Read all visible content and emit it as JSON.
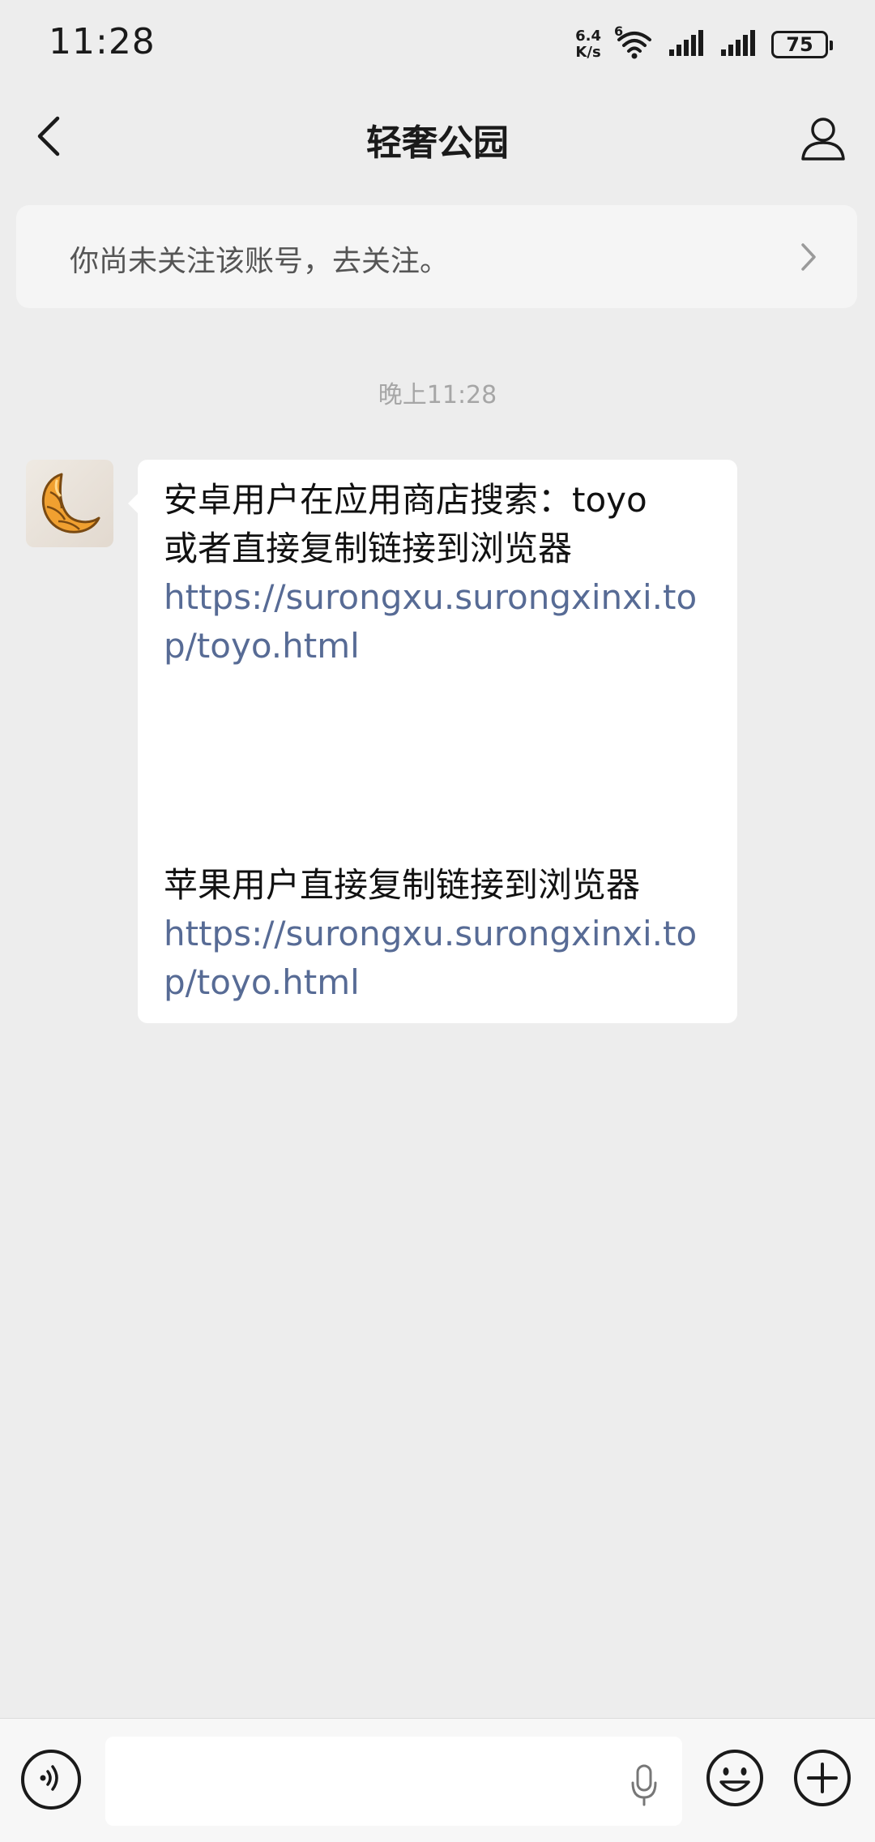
{
  "status_bar": {
    "time": "11:28",
    "net_speed_value": "6.4",
    "net_speed_unit": "K/s",
    "network_type": "6",
    "battery": "75"
  },
  "nav": {
    "title": "轻奢公园"
  },
  "follow_banner": {
    "text": "你尚未关注该账号，去关注。"
  },
  "chat": {
    "timestamp": "晚上11:28",
    "message": {
      "android_line1": "安卓用户在应用商店搜索：toyo",
      "android_line2": "或者直接复制链接到浏览器",
      "android_link": "https://surongxu.surongxinxi.top/toyo.html",
      "ios_line": "苹果用户直接复制链接到浏览器",
      "ios_link": "https://surongxu.surongxinxi.top/toyo.html"
    }
  },
  "input_bar": {
    "value": "",
    "placeholder": ""
  },
  "colors": {
    "background": "#ededed",
    "link": "#576b95",
    "bubble": "#ffffff",
    "avatar_accent": "#f0a030"
  }
}
